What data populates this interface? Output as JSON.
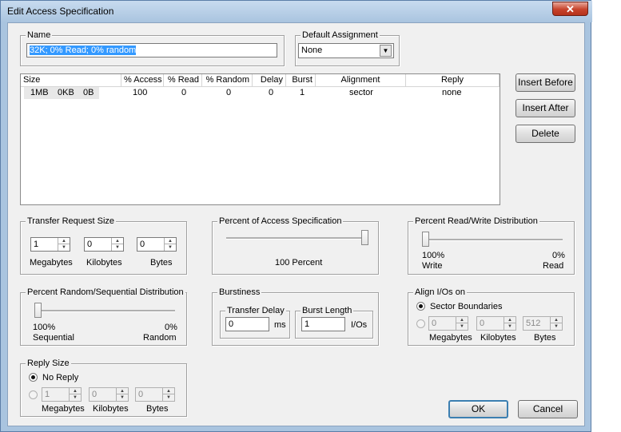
{
  "window": {
    "title": "Edit Access Specification",
    "close_glyph": "✕"
  },
  "name_group": {
    "legend": "Name",
    "value": "32K; 0% Read; 0% random"
  },
  "default_assignment": {
    "legend": "Default Assignment",
    "selected": "None"
  },
  "table": {
    "columns": [
      "Size",
      "% Access",
      "% Read",
      "% Random",
      "Delay",
      "Burst",
      "Alignment",
      "Reply"
    ],
    "rows": [
      {
        "size_mb": "1MB",
        "size_kb": "0KB",
        "size_b": "0B",
        "access": "100",
        "read": "0",
        "random": "0",
        "delay": "0",
        "burst": "1",
        "alignment": "sector",
        "reply": "none"
      }
    ]
  },
  "side_buttons": {
    "insert_before": "Insert Before",
    "insert_after": "Insert After",
    "delete": "Delete"
  },
  "transfer_size": {
    "legend": "Transfer Request Size",
    "mb": "1",
    "kb": "0",
    "b": "0",
    "mb_label": "Megabytes",
    "kb_label": "Kilobytes",
    "b_label": "Bytes"
  },
  "percent_access": {
    "legend": "Percent of Access Specification",
    "label": "100 Percent",
    "value_percent": 100
  },
  "read_write": {
    "legend": "Percent Read/Write Distribution",
    "left_pct": "100%",
    "left_label": "Write",
    "right_pct": "0%",
    "right_label": "Read",
    "read_percent": 0
  },
  "random_seq": {
    "legend": "Percent Random/Sequential Distribution",
    "left_pct": "100%",
    "left_label": "Sequential",
    "right_pct": "0%",
    "right_label": "Random",
    "random_percent": 0
  },
  "burstiness": {
    "legend": "Burstiness",
    "delay_legend": "Transfer Delay",
    "delay_value": "0",
    "delay_unit": "ms",
    "burst_legend": "Burst Length",
    "burst_value": "1",
    "burst_unit": "I/Os"
  },
  "align": {
    "legend": "Align I/Os on",
    "sector_label": "Sector Boundaries",
    "mb": "0",
    "kb": "0",
    "b": "512",
    "mb_label": "Megabytes",
    "kb_label": "Kilobytes",
    "b_label": "Bytes"
  },
  "reply": {
    "legend": "Reply Size",
    "no_reply_label": "No Reply",
    "mb": "1",
    "kb": "0",
    "b": "0",
    "mb_label": "Megabytes",
    "kb_label": "Kilobytes",
    "b_label": "Bytes"
  },
  "buttons": {
    "ok": "OK",
    "cancel": "Cancel"
  },
  "dropdown_arrow": "▼",
  "spin_up": "▲",
  "spin_down": "▼"
}
